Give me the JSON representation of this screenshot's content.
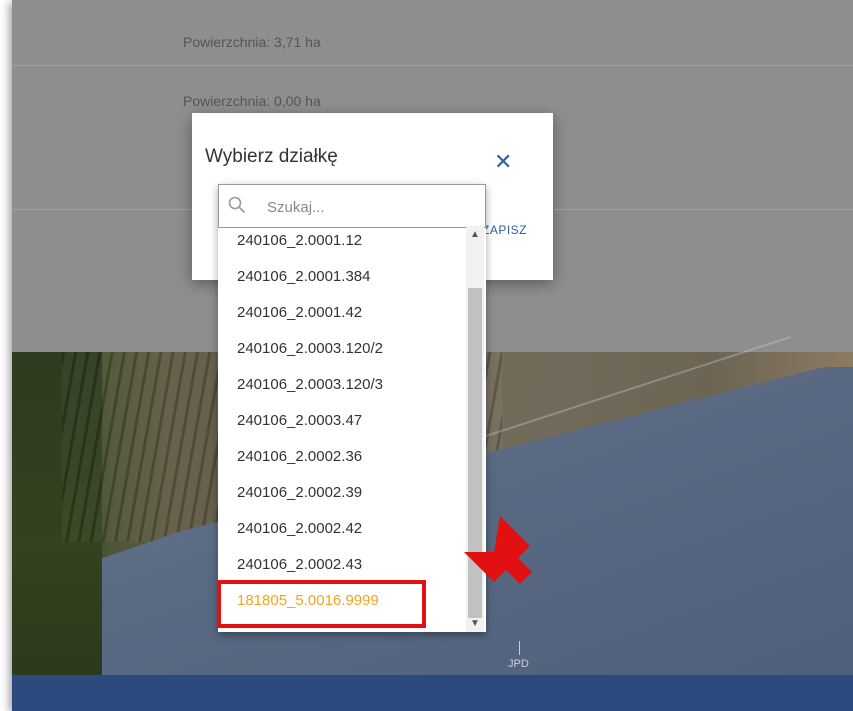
{
  "background_form": {
    "rows": [
      {
        "text": "Powierzchnia: 3,71 ha"
      },
      {
        "text": "Powierzchnia: 0,00 ha"
      }
    ]
  },
  "modal": {
    "title": "Wybierz działkę",
    "close_icon": "close-icon",
    "save_label": "ZAPISZ"
  },
  "dropdown": {
    "search_placeholder": "Szukaj...",
    "items": [
      "240106_2.0001.12",
      "240106_2.0001.384",
      "240106_2.0001.42",
      "240106_2.0003.120/2",
      "240106_2.0003.120/3",
      "240106_2.0003.47",
      "240106_2.0002.36",
      "240106_2.0002.39",
      "240106_2.0002.42",
      "240106_2.0002.43",
      "181805_5.0016.9999"
    ],
    "selected_index": 10
  },
  "map": {
    "label": "JPD"
  },
  "colors": {
    "accent": "#2e5fa3",
    "highlight_text": "#f2a516",
    "annotation_red": "#e11111",
    "bottom_bar": "#2d4a7e"
  }
}
